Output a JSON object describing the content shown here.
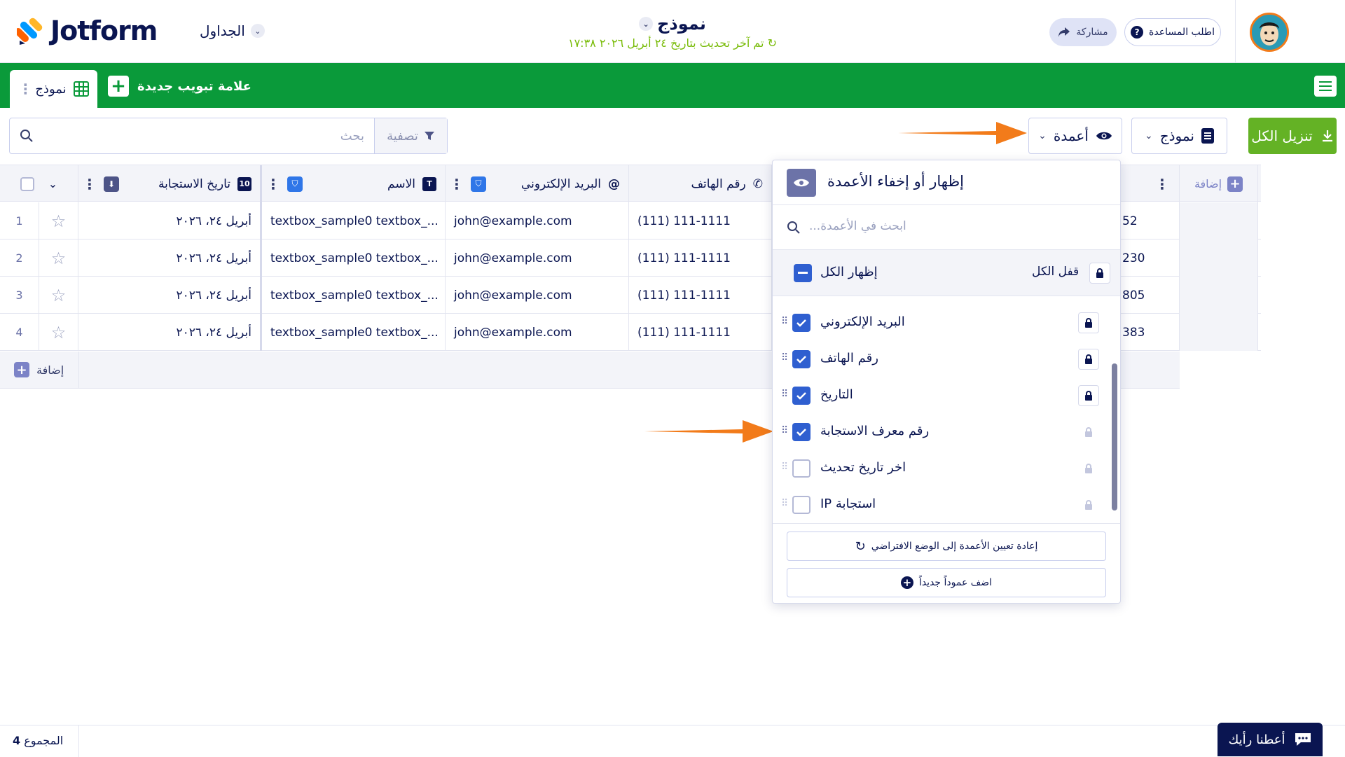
{
  "header": {
    "logo_text": "Jotform",
    "tables_label": "الجداول",
    "title": "نموذج",
    "updated": "تم آخر تحديث بتاريخ ٢٤ أبريل ٢٠٢٦ ١٧:٣٨",
    "share_label": "مشاركة",
    "help_label": "اطلب المساعدة"
  },
  "tabs": {
    "active_label": "نموذج",
    "add_label": "علامة تبويب جديدة"
  },
  "toolbar": {
    "search_placeholder": "بحث",
    "filter_label": "تصفية",
    "download_label": "تنزيل الكل",
    "form_label": "نموذج",
    "columns_label": "أعمدة"
  },
  "table": {
    "columns": [
      "تاريخ الاستجابة",
      "الاسم",
      "البريد الإلكتروني",
      "رقم الهاتف"
    ],
    "rows": [
      {
        "num": "1",
        "date": "أبريل ٢٤، ٢٠٢٦",
        "name": "textbox_sample0 textbox_...",
        "email": "john@example.com",
        "phone": "(111) 111-1111",
        "id_tail": "52"
      },
      {
        "num": "2",
        "date": "أبريل ٢٤، ٢٠٢٦",
        "name": "textbox_sample0 textbox_...",
        "email": "john@example.com",
        "phone": "(111) 111-1111",
        "id_tail": "230"
      },
      {
        "num": "3",
        "date": "أبريل ٢٤، ٢٠٢٦",
        "name": "textbox_sample0 textbox_...",
        "email": "john@example.com",
        "phone": "(111) 111-1111",
        "id_tail": "805"
      },
      {
        "num": "4",
        "date": "أبريل ٢٤، ٢٠٢٦",
        "name": "textbox_sample0 textbox_...",
        "email": "john@example.com",
        "phone": "(111) 111-1111",
        "id_tail": "383"
      }
    ],
    "add_row_label": "إضافة",
    "add_col_label": "إضافة"
  },
  "popup": {
    "title": "إظهار أو إخفاء الأعمدة",
    "search_placeholder": "...ابحث في الأعمدة",
    "show_all_label": "إظهار الكل",
    "lock_all_label": "قفل الكل",
    "items": [
      {
        "label": "البريد الإلكتروني",
        "checked": true
      },
      {
        "label": "رقم الهاتف",
        "checked": true
      },
      {
        "label": "التاريخ",
        "checked": true
      },
      {
        "label": "رقم معرف الاستجابة",
        "checked": true
      },
      {
        "label": "اخر تاريخ تحديث",
        "checked": false
      },
      {
        "label": "استجابة IP",
        "checked": false
      }
    ],
    "reset_label": "إعادة تعيين الأعمدة إلى الوضع الافتراضي",
    "add_new_label": "اضف عموداً جديداً"
  },
  "footer": {
    "total_label": "المجموع",
    "total_count": "4",
    "feedback_label": "أعطنا رأيك"
  },
  "colors": {
    "brand_green": "#0a9a3a",
    "download_green": "#64b225",
    "navy": "#0a1551",
    "checkbox_blue": "#2f5fd0",
    "annotation_orange": "#f27b1a"
  }
}
